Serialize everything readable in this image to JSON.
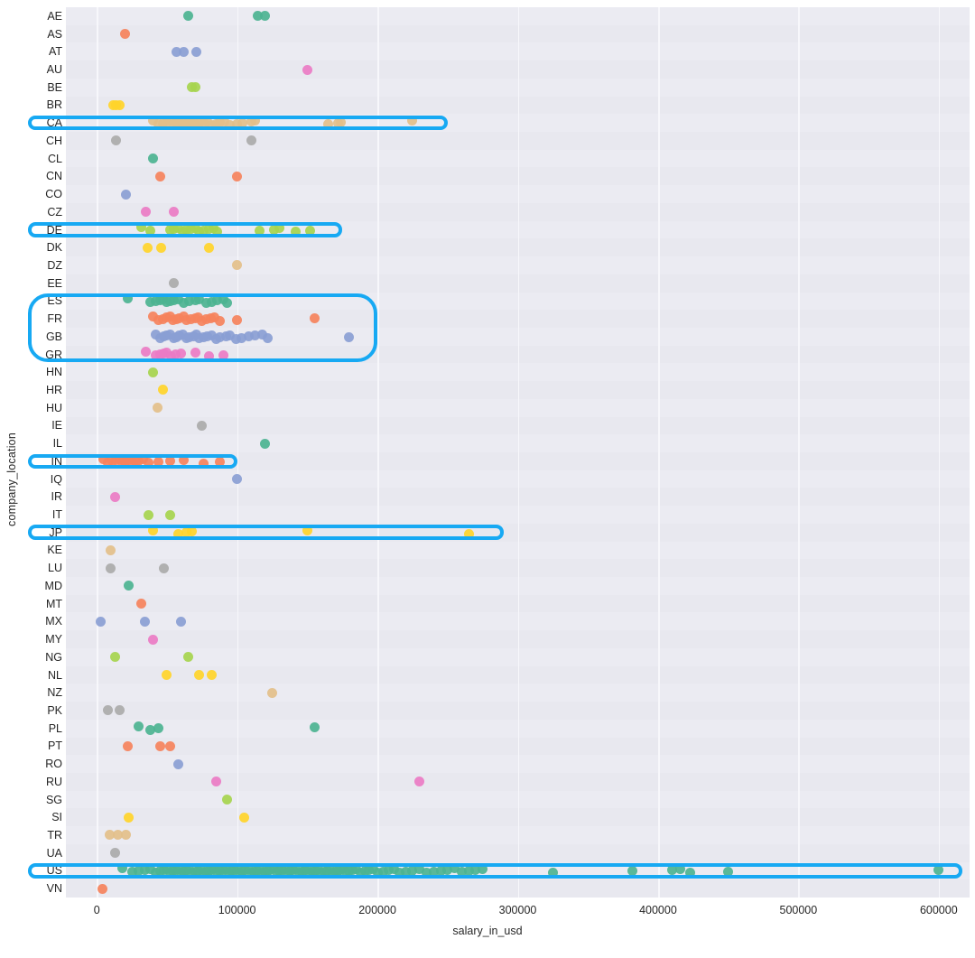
{
  "axes": {
    "ylabel": "company_location",
    "xlabel": "salary_in_usd",
    "xticks": [
      "0",
      "100000",
      "200000",
      "300000",
      "400000",
      "500000",
      "600000"
    ],
    "xtick_values": [
      0,
      100000,
      200000,
      300000,
      400000,
      500000,
      600000
    ]
  },
  "colors": {
    "background": "#ffffff",
    "plot_bg": "#eaeaf1",
    "grid": "#f7f7fb",
    "highlight": "#17a9f3",
    "text": "#262626",
    "palette": [
      "#4cb391",
      "#f5825c",
      "#8a9ed4",
      "#ea7bc4",
      "#a6d44e",
      "#ffd42a",
      "#e3bf8a",
      "#aaaaaa",
      "#5ec4a4",
      "#f08a6a"
    ]
  },
  "chart_data": {
    "type": "scatter",
    "title": "",
    "xlabel": "salary_in_usd",
    "ylabel": "company_location",
    "xlim": [
      -22000,
      622000
    ],
    "grid": true,
    "legend": null,
    "categories": [
      "AE",
      "AS",
      "AT",
      "AU",
      "BE",
      "BR",
      "CA",
      "CH",
      "CL",
      "CN",
      "CO",
      "CZ",
      "DE",
      "DK",
      "DZ",
      "EE",
      "ES",
      "FR",
      "GB",
      "GR",
      "HN",
      "HR",
      "HU",
      "IE",
      "IL",
      "IN",
      "IQ",
      "IR",
      "IT",
      "JP",
      "KE",
      "LU",
      "MD",
      "MT",
      "MX",
      "MY",
      "NG",
      "NL",
      "NZ",
      "PK",
      "PL",
      "PT",
      "RO",
      "RU",
      "SG",
      "SI",
      "TR",
      "UA",
      "US",
      "VN"
    ],
    "highlighted_categories": [
      "CA",
      "DE",
      "ES",
      "FR",
      "GB",
      "GR",
      "IN",
      "JP",
      "US"
    ],
    "series": [
      {
        "name": "AE",
        "color": "#4cb391",
        "values": [
          65000,
          115000,
          120000
        ]
      },
      {
        "name": "AS",
        "color": "#f5825c",
        "values": [
          20000
        ]
      },
      {
        "name": "AT",
        "color": "#8a9ed4",
        "values": [
          57000,
          62000,
          71000
        ]
      },
      {
        "name": "AU",
        "color": "#ea7bc4",
        "values": [
          150000
        ]
      },
      {
        "name": "BE",
        "color": "#a6d44e",
        "values": [
          68000,
          70000
        ]
      },
      {
        "name": "BR",
        "color": "#ffd42a",
        "values": [
          12000,
          14000,
          16000
        ]
      },
      {
        "name": "CA",
        "color": "#e3bf8a",
        "values": [
          40000,
          44000,
          47000,
          50000,
          52000,
          55000,
          57000,
          59000,
          61000,
          63000,
          65000,
          67000,
          69000,
          71000,
          73000,
          76000,
          79000,
          82000,
          85000,
          88000,
          91000,
          95000,
          100000,
          104000,
          110000,
          113000,
          165000,
          172000,
          174000,
          225000
        ]
      },
      {
        "name": "CH",
        "color": "#aaaaaa",
        "values": [
          14000,
          110000
        ]
      },
      {
        "name": "CL",
        "color": "#4cb391",
        "values": [
          40000
        ]
      },
      {
        "name": "CN",
        "color": "#f5825c",
        "values": [
          45000,
          100000
        ]
      },
      {
        "name": "CO",
        "color": "#8a9ed4",
        "values": [
          21000
        ]
      },
      {
        "name": "CZ",
        "color": "#ea7bc4",
        "values": [
          35000,
          55000
        ]
      },
      {
        "name": "DE",
        "color": "#a6d44e",
        "values": [
          32000,
          38000,
          52000,
          55000,
          58000,
          61000,
          64000,
          67000,
          70000,
          73000,
          76000,
          80000,
          83000,
          86000,
          116000,
          126000,
          130000,
          142000,
          152000
        ]
      },
      {
        "name": "DK",
        "color": "#ffd42a",
        "values": [
          36000,
          46000,
          80000
        ]
      },
      {
        "name": "DZ",
        "color": "#e3bf8a",
        "values": [
          100000
        ]
      },
      {
        "name": "EE",
        "color": "#aaaaaa",
        "values": [
          55000
        ]
      },
      {
        "name": "ES",
        "color": "#4cb391",
        "values": [
          22000,
          38000,
          42000,
          45000,
          47000,
          50000,
          52000,
          55000,
          58000,
          62000,
          66000,
          70000,
          73000,
          78000,
          82000,
          86000,
          90000,
          93000
        ]
      },
      {
        "name": "FR",
        "color": "#f5825c",
        "values": [
          40000,
          44000,
          47000,
          50000,
          52000,
          54000,
          57000,
          59000,
          62000,
          64000,
          67000,
          70000,
          72000,
          75000,
          78000,
          81000,
          84000,
          88000,
          100000,
          155000
        ]
      },
      {
        "name": "GB",
        "color": "#8a9ed4",
        "values": [
          42000,
          45000,
          48000,
          50000,
          52000,
          55000,
          57000,
          59000,
          61000,
          64000,
          66000,
          69000,
          71000,
          73000,
          76000,
          79000,
          82000,
          85000,
          88000,
          92000,
          95000,
          99000,
          103000,
          108000,
          113000,
          118000,
          122000,
          180000
        ]
      },
      {
        "name": "GR",
        "color": "#ea7bc4",
        "values": [
          35000,
          42000,
          45000,
          48000,
          50000,
          53000,
          56000,
          60000,
          70000,
          80000,
          90000
        ]
      },
      {
        "name": "HN",
        "color": "#a6d44e",
        "values": [
          40000
        ]
      },
      {
        "name": "HR",
        "color": "#ffd42a",
        "values": [
          47000
        ]
      },
      {
        "name": "HU",
        "color": "#e3bf8a",
        "values": [
          43000
        ]
      },
      {
        "name": "IE",
        "color": "#aaaaaa",
        "values": [
          75000
        ]
      },
      {
        "name": "IL",
        "color": "#4cb391",
        "values": [
          120000
        ]
      },
      {
        "name": "IN",
        "color": "#f5825c",
        "values": [
          5000,
          8000,
          11000,
          14000,
          16000,
          18000,
          20000,
          22000,
          24000,
          26000,
          28000,
          30000,
          33000,
          37000,
          44000,
          52000,
          62000,
          76000,
          88000
        ]
      },
      {
        "name": "IQ",
        "color": "#8a9ed4",
        "values": [
          100000
        ]
      },
      {
        "name": "IR",
        "color": "#ea7bc4",
        "values": [
          13000
        ]
      },
      {
        "name": "IT",
        "color": "#a6d44e",
        "values": [
          37000,
          52000
        ]
      },
      {
        "name": "JP",
        "color": "#ffd42a",
        "values": [
          40000,
          58000,
          64000,
          68000,
          150000,
          265000
        ]
      },
      {
        "name": "KE",
        "color": "#e3bf8a",
        "values": [
          10000
        ]
      },
      {
        "name": "LU",
        "color": "#aaaaaa",
        "values": [
          10000,
          48000
        ]
      },
      {
        "name": "MD",
        "color": "#4cb391",
        "values": [
          23000
        ]
      },
      {
        "name": "MT",
        "color": "#f5825c",
        "values": [
          32000
        ]
      },
      {
        "name": "MX",
        "color": "#8a9ed4",
        "values": [
          3000,
          34000,
          60000
        ]
      },
      {
        "name": "MY",
        "color": "#ea7bc4",
        "values": [
          40000
        ]
      },
      {
        "name": "NG",
        "color": "#a6d44e",
        "values": [
          13000,
          65000
        ]
      },
      {
        "name": "NL",
        "color": "#ffd42a",
        "values": [
          50000,
          73000,
          82000
        ]
      },
      {
        "name": "NZ",
        "color": "#e3bf8a",
        "values": [
          125000
        ]
      },
      {
        "name": "PK",
        "color": "#aaaaaa",
        "values": [
          8000,
          16000
        ]
      },
      {
        "name": "PL",
        "color": "#4cb391",
        "values": [
          30000,
          38000,
          44000,
          155000
        ]
      },
      {
        "name": "PT",
        "color": "#f5825c",
        "values": [
          22000,
          45000,
          52000
        ]
      },
      {
        "name": "RO",
        "color": "#8a9ed4",
        "values": [
          58000
        ]
      },
      {
        "name": "RU",
        "color": "#ea7bc4",
        "values": [
          85000,
          230000
        ]
      },
      {
        "name": "SG",
        "color": "#a6d44e",
        "values": [
          93000
        ]
      },
      {
        "name": "SI",
        "color": "#ffd42a",
        "values": [
          23000,
          105000
        ]
      },
      {
        "name": "TR",
        "color": "#e3bf8a",
        "values": [
          9000,
          15000,
          21000
        ]
      },
      {
        "name": "UA",
        "color": "#aaaaaa",
        "values": [
          13000
        ]
      },
      {
        "name": "US",
        "color": "#4cb391",
        "values": [
          18000,
          25000,
          30000,
          34000,
          38000,
          42000,
          45000,
          48000,
          50000,
          52000,
          54000,
          56000,
          58000,
          60000,
          62000,
          64000,
          66000,
          68000,
          70000,
          72000,
          74000,
          76000,
          78000,
          80000,
          82000,
          84000,
          86000,
          88000,
          90000,
          92000,
          94000,
          96000,
          98000,
          100000,
          102000,
          104000,
          106000,
          108000,
          110000,
          112000,
          114000,
          116000,
          118000,
          120000,
          122000,
          124000,
          126000,
          128000,
          130000,
          132000,
          134000,
          136000,
          138000,
          140000,
          142000,
          144000,
          146000,
          148000,
          150000,
          152000,
          154000,
          156000,
          158000,
          160000,
          162000,
          164000,
          166000,
          168000,
          170000,
          172000,
          174000,
          176000,
          178000,
          180000,
          182000,
          185000,
          188000,
          191000,
          194000,
          197000,
          200000,
          204000,
          208000,
          212000,
          216000,
          220000,
          225000,
          230000,
          235000,
          240000,
          245000,
          250000,
          255000,
          260000,
          265000,
          270000,
          275000,
          325000,
          382000,
          410000,
          416000,
          423000,
          450000,
          600000
        ]
      },
      {
        "name": "VN",
        "color": "#f5825c",
        "values": [
          4000
        ]
      }
    ]
  }
}
